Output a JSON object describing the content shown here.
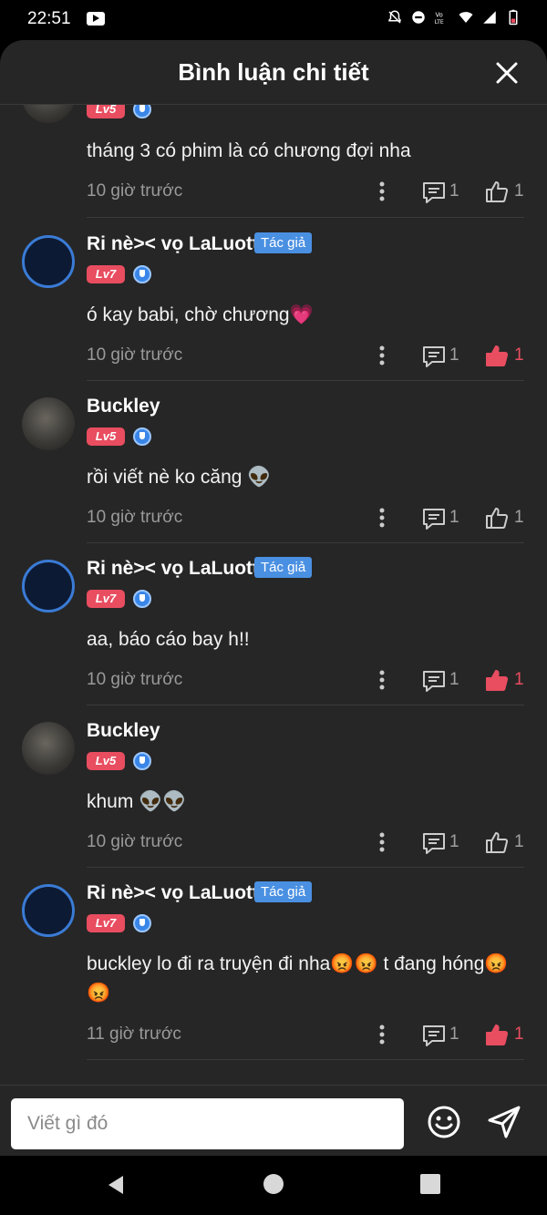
{
  "status_bar": {
    "time": "22:51"
  },
  "header": {
    "title": "Bình luận chi tiết"
  },
  "partial_comment": {
    "level": "Lv5",
    "text": "tháng 3 có phim là có chương đợi nha",
    "time": "10 giờ trước",
    "reply_count": "1",
    "like_count": "1",
    "liked": false
  },
  "comments": [
    {
      "user": "Ri nè>< vọ LaLuott",
      "author_tag": "Tác giả",
      "level": "Lv7",
      "text": "ó kay babi, chờ chương💗",
      "time": "10 giờ trước",
      "reply_count": "1",
      "like_count": "1",
      "liked": true
    },
    {
      "user": "Buckley",
      "author_tag": "",
      "level": "Lv5",
      "text": "rồi viết nè ko căng 👽",
      "time": "10 giờ trước",
      "reply_count": "1",
      "like_count": "1",
      "liked": false
    },
    {
      "user": "Ri nè>< vọ LaLuott",
      "author_tag": "Tác giả",
      "level": "Lv7",
      "text": "aa, báo cáo bay h!!",
      "time": "10 giờ trước",
      "reply_count": "1",
      "like_count": "1",
      "liked": true
    },
    {
      "user": "Buckley",
      "author_tag": "",
      "level": "Lv5",
      "text": "khum 👽👽",
      "time": "10 giờ trước",
      "reply_count": "1",
      "like_count": "1",
      "liked": false
    },
    {
      "user": "Ri nè>< vọ LaLuott",
      "author_tag": "Tác giả",
      "level": "Lv7",
      "text": "buckley lo đi ra truyện đi nha😡😡 t đang hóng😡😡",
      "time": "11 giờ trước",
      "reply_count": "1",
      "like_count": "1",
      "liked": true
    }
  ],
  "composer": {
    "placeholder": "Viết gì đó"
  },
  "colors": {
    "accent_like": "#e84d60",
    "author_tag": "#4a90e2",
    "background": "#262626"
  },
  "icons": [
    "youtube-icon",
    "close-icon",
    "more-vert-icon",
    "comment-icon",
    "thumbs-up-icon",
    "emoji-icon",
    "send-icon",
    "nav-back-icon",
    "nav-home-icon",
    "nav-recent-icon"
  ]
}
